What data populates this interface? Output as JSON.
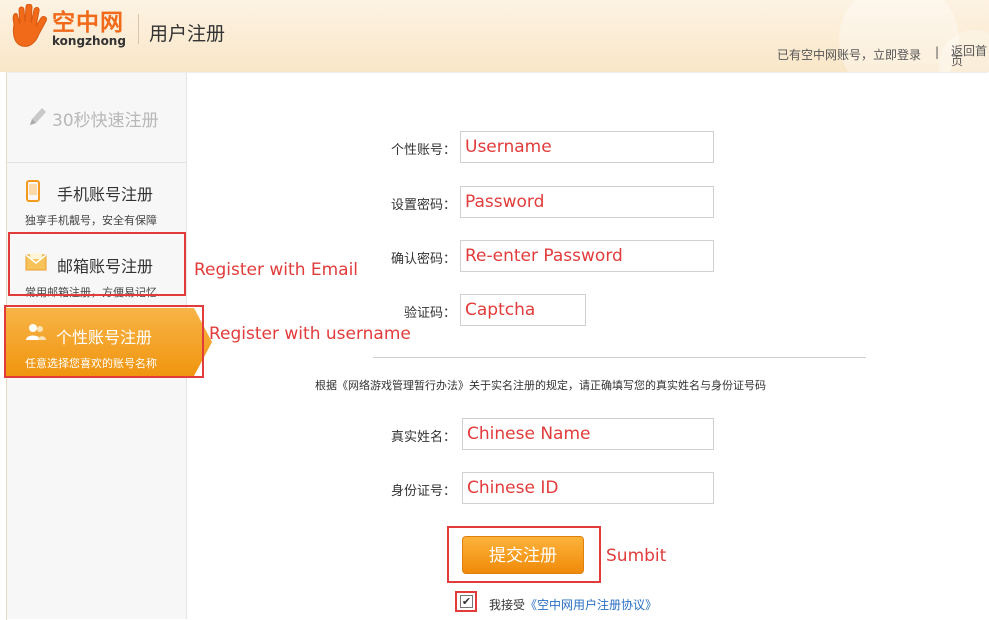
{
  "header": {
    "logo_cn": "空中网",
    "logo_en": "kongzhong",
    "page_title": "用户注册",
    "login_link": "已有空中网账号，立即登录",
    "separator": "|",
    "home_link": "返回首页"
  },
  "sidebar": {
    "quick": "30秒快速注册",
    "items": [
      {
        "title": "手机账号注册",
        "sub": "独享手机靓号，安全有保障",
        "icon": "phone-icon"
      },
      {
        "title": "邮箱账号注册",
        "sub": "常用邮箱注册，方便易记忆",
        "icon": "envelope-icon"
      },
      {
        "title": "个性账号注册",
        "sub": "任意选择您喜欢的账号名称",
        "icon": "users-icon"
      }
    ]
  },
  "form": {
    "username_label": "个性账号：",
    "username_value": "Username",
    "password_label": "设置密码：",
    "password_value": "Password",
    "confirm_label": "确认密码：",
    "confirm_value": "Re-enter Password",
    "captcha_label": "验证码：",
    "captcha_value": "Captcha",
    "notice": "根据《网络游戏管理暂行办法》关于实名注册的规定，请正确填写您的真实姓名与身份证号码",
    "realname_label": "真实姓名：",
    "realname_value": "Chinese Name",
    "id_label": "身份证号：",
    "id_value": "Chinese ID",
    "submit_label": "提交注册",
    "agree_prefix": "我接受",
    "agree_link": "《空中网用户注册协议》",
    "checkbox_checked": true
  },
  "annotations": {
    "email": "Register with Email",
    "username": "Register with username",
    "submit": "Sumbit"
  },
  "colors": {
    "accent_orange": "#f39a1e",
    "annotation_red": "#e23b3b",
    "link_blue": "#2a6fc4"
  }
}
